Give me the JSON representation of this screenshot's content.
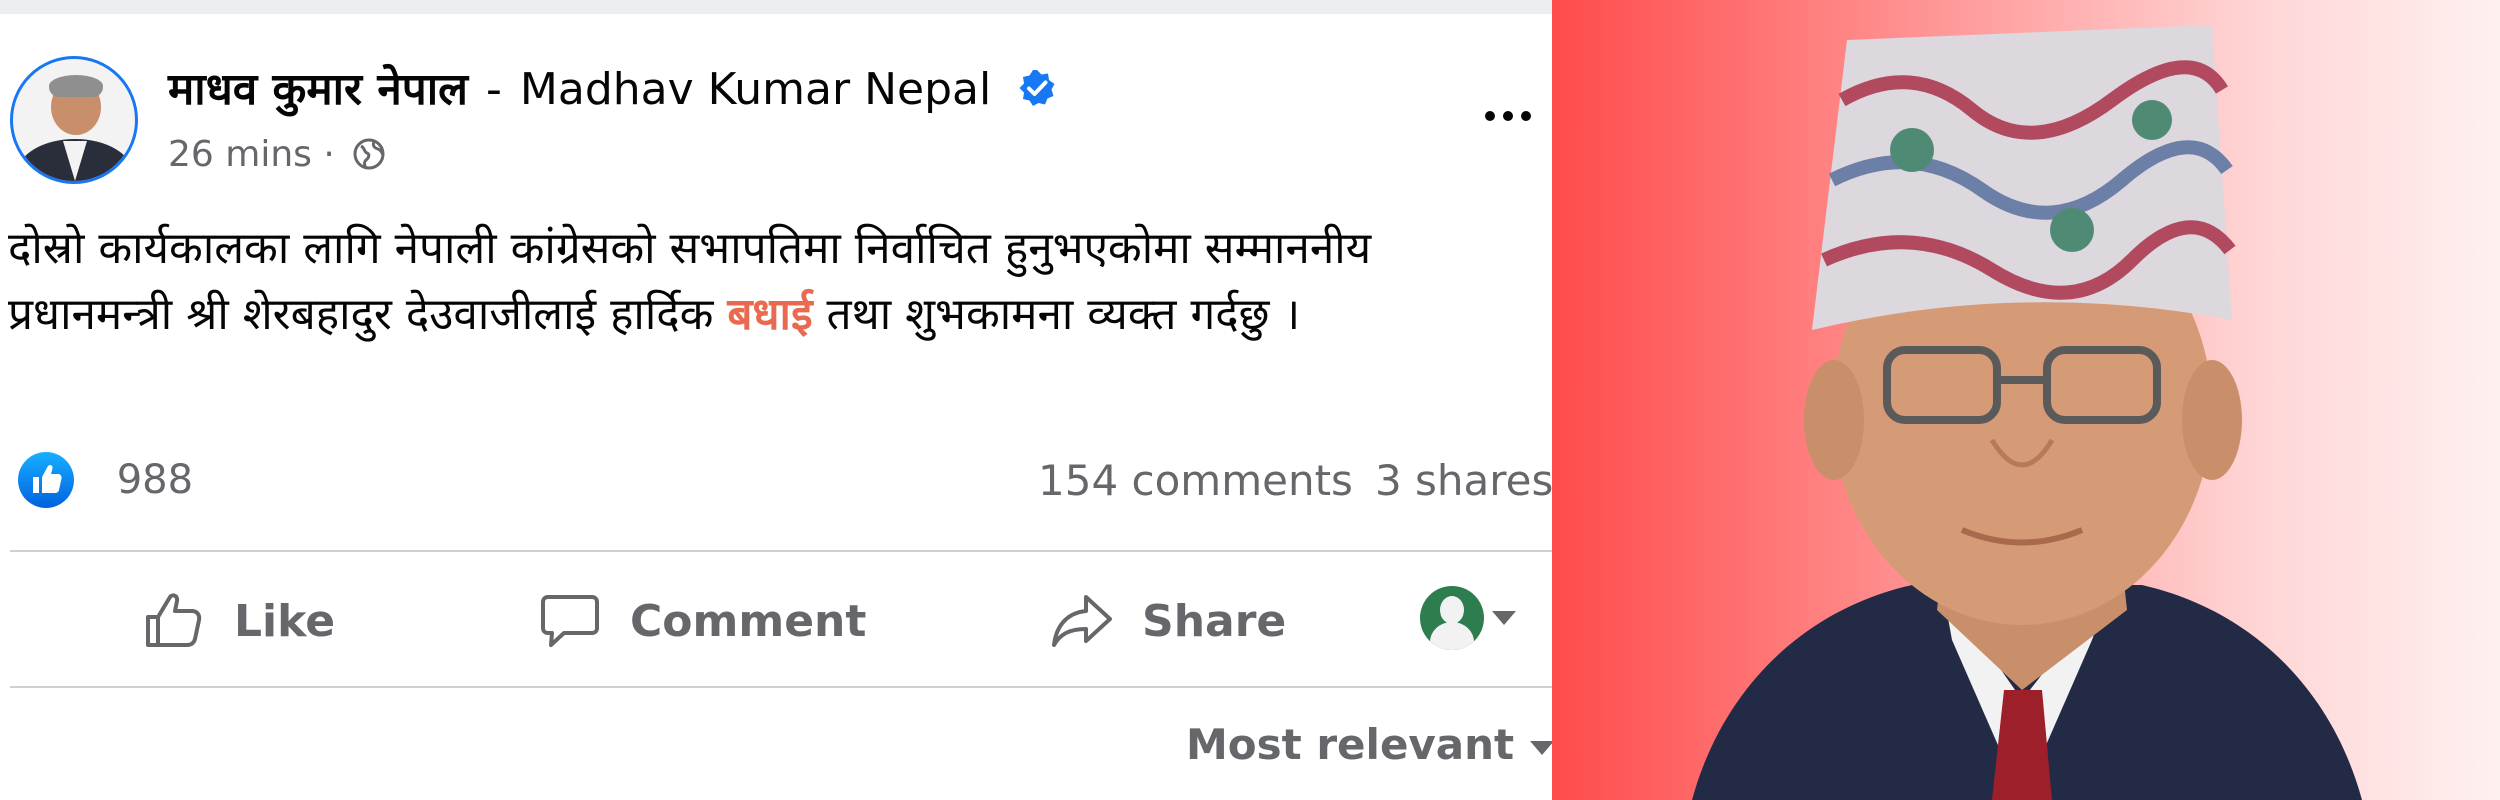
{
  "post": {
    "author_nepali": "माधव कुमार नेपाल",
    "author_separator": "-",
    "author_english": "Madhav Kumar Nepal",
    "timestamp": "26 mins",
    "meta_separator": "·",
    "text_before": "दोस्रो कार्यकालका लागि नेपाली कांग्रेसको सभापतिमा निर्वाचित हुनुभएकोमा सम्माननीय प्रधानमन्त्री श्री शेरबहादुर देउवाजीलाई हार्दिक ",
    "text_highlight": "बधाई",
    "text_after": " तथा शुभकामना व्यक्त गर्दछु ।",
    "highlight_color": "#e96b4f"
  },
  "stats": {
    "reaction_count": "988",
    "comments": "154 comments",
    "shares": "3 shares"
  },
  "actions": {
    "like": "Like",
    "comment": "Comment",
    "share": "Share"
  },
  "comments_sort": "Most relevant",
  "icons": {
    "verified": "verified-badge-icon",
    "audience": "globe-icon",
    "more": "more-options-icon",
    "reaction": "like-reaction-icon",
    "like": "thumbs-up-icon",
    "comment": "speech-bubble-icon",
    "share": "share-arrow-icon"
  },
  "colors": {
    "brand_blue": "#1877f2",
    "secondary_text": "#65676b",
    "divider": "#ced0d4",
    "photo_background": "#ff4b4b"
  }
}
